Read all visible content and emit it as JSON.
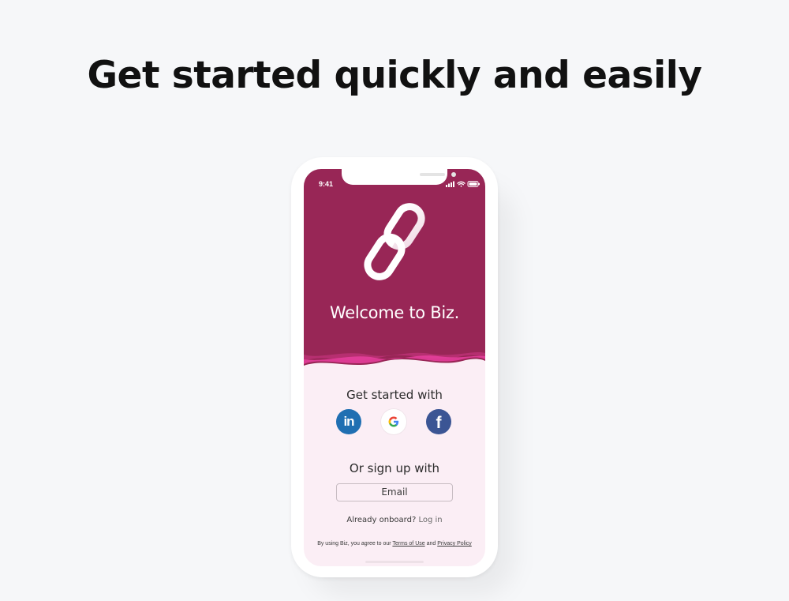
{
  "headline": "Get started quickly and easily",
  "phone": {
    "status_time": "9:41",
    "welcome": "Welcome to Biz.",
    "get_started_label": "Get started with",
    "social": [
      {
        "name": "linkedin-icon",
        "glyph": "in"
      },
      {
        "name": "google-icon",
        "glyph": "G"
      },
      {
        "name": "facebook-icon",
        "glyph": "f"
      }
    ],
    "or_signup_label": "Or sign up with",
    "email_button": "Email",
    "already_text": "Already onboard?",
    "login_link": "Log in",
    "legal_prefix": "By using Biz, you agree to our",
    "terms_link": "Terms of Use",
    "legal_and": "and",
    "privacy_link": "Privacy Policy"
  },
  "colors": {
    "brand_maroon": "#982656",
    "wave_pink": "#e83f9d",
    "screen_bottom": "#fbeef5",
    "linkedin": "#1f6fb2",
    "facebook": "#3b5594"
  }
}
